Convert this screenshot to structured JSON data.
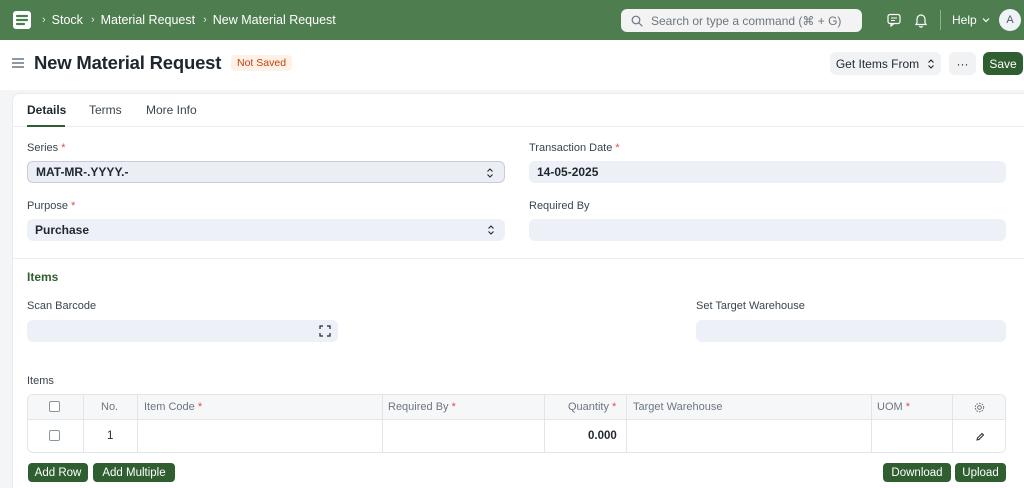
{
  "navbar": {
    "breadcrumbs": [
      "Stock",
      "Material Request",
      "New Material Request"
    ],
    "search_placeholder": "Search or type a command (⌘ + G)",
    "help_label": "Help",
    "avatar_initial": "A"
  },
  "page": {
    "title": "New Material Request",
    "status": "Not Saved",
    "get_items_label": "Get Items From",
    "more_label": "···",
    "save_label": "Save"
  },
  "tabs": [
    "Details",
    "Terms",
    "More Info"
  ],
  "form": {
    "series_label": "Series",
    "series_value": "MAT-MR-.YYYY.-",
    "transaction_date_label": "Transaction Date",
    "transaction_date_value": "14-05-2025",
    "purpose_label": "Purpose",
    "purpose_value": "Purchase",
    "required_by_label": "Required By",
    "required_by_value": "",
    "required_mark": "*"
  },
  "items_section": {
    "heading": "Items",
    "scan_barcode_label": "Scan Barcode",
    "set_target_warehouse_label": "Set Target Warehouse",
    "grid_label": "Items",
    "columns": {
      "no": "No.",
      "item_code": "Item Code",
      "required_by": "Required By",
      "quantity": "Quantity",
      "target_warehouse": "Target Warehouse",
      "uom": "UOM"
    },
    "rows": [
      {
        "no": "1",
        "item_code": "",
        "required_by": "",
        "quantity": "0.000",
        "target_warehouse": "",
        "uom": ""
      }
    ],
    "add_row_label": "Add Row",
    "add_multiple_label": "Add Multiple",
    "download_label": "Download",
    "upload_label": "Upload"
  },
  "colors": {
    "navbar": "#4e7d4f",
    "primary_button": "#2f5e31",
    "status_text": "#c2410c"
  }
}
